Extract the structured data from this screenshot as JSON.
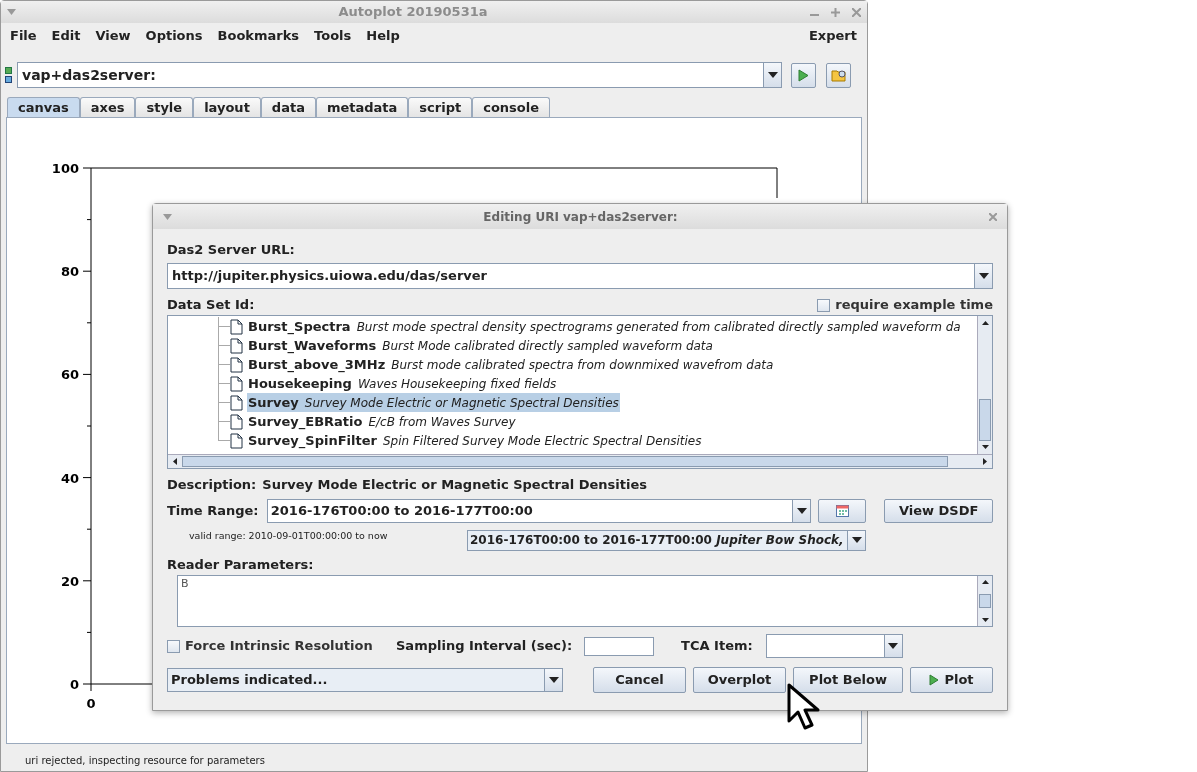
{
  "window": {
    "title": "Autoplot 20190531a"
  },
  "menu": [
    "File",
    "Edit",
    "View",
    "Options",
    "Bookmarks",
    "Tools",
    "Help"
  ],
  "menu_right": "Expert",
  "uri_field": {
    "value": "vap+das2server:"
  },
  "tabs": [
    {
      "label": "canvas",
      "selected": true
    },
    {
      "label": "axes",
      "selected": false
    },
    {
      "label": "style",
      "selected": false
    },
    {
      "label": "layout",
      "selected": false
    },
    {
      "label": "data",
      "selected": false
    },
    {
      "label": "metadata",
      "selected": false
    },
    {
      "label": "script",
      "selected": false
    },
    {
      "label": "console",
      "selected": false
    }
  ],
  "plot": {
    "y_ticks": [
      "100",
      "80",
      "60",
      "40",
      "20",
      "0"
    ],
    "x_ticks": [
      "0"
    ]
  },
  "status_bar": "uri rejected, inspecting resource for parameters",
  "dialog": {
    "title": "Editing URI vap+das2server:",
    "server_url_label": "Das2 Server URL:",
    "server_url": "http://jupiter.physics.uiowa.edu/das/server",
    "dataset_label": "Data Set Id:",
    "require_example_time": {
      "label": "require example time",
      "checked": false
    },
    "datasets": [
      {
        "name": "Burst_Spectra",
        "description": "Burst mode spectral density spectrograms generated from calibrated directly sampled waveform da",
        "selected": false
      },
      {
        "name": "Burst_Waveforms",
        "description": "Burst Mode calibrated directly sampled waveform data",
        "selected": false
      },
      {
        "name": "Burst_above_3MHz",
        "description": "Burst mode calibrated spectra from downmixed wavefrom data",
        "selected": false
      },
      {
        "name": "Housekeeping",
        "description": "Waves Housekeeping fixed fields",
        "selected": false
      },
      {
        "name": "Survey",
        "description": "Survey Mode Electric or Magnetic Spectral Densities",
        "selected": true
      },
      {
        "name": "Survey_EBRatio",
        "description": "E/cB from Waves Survey",
        "selected": false
      },
      {
        "name": "Survey_SpinFilter",
        "description": "Spin Filtered Survey Mode Electric Spectral Densities",
        "selected": false
      }
    ],
    "description_label": "Description:",
    "description": "Survey Mode Electric or Magnetic Spectral Densities",
    "time_range_label": "Time Range:",
    "time_range": "2016-176T00:00 to 2016-177T00:00",
    "view_dsdf": "View DSDF",
    "valid_range": "valid range: 2010-09-01T00:00:00 to now",
    "example_time": {
      "range": "2016-176T00:00 to 2016-177T00:00",
      "note": "Jupiter Bow Shock,"
    },
    "reader_params_label": "Reader Parameters:",
    "reader_params": "B",
    "force_intrinsic": {
      "label": "Force Intrinsic Resolution",
      "checked": false
    },
    "sampling_label": "Sampling Interval (sec):",
    "tca_label": "TCA Item:",
    "problems": "Problems indicated...",
    "buttons": [
      {
        "label": "Cancel",
        "kind": "plain"
      },
      {
        "label": "Overplot",
        "kind": "plain"
      },
      {
        "label": "Plot Below",
        "kind": "plain"
      },
      {
        "label": "Plot",
        "kind": "play"
      }
    ]
  }
}
